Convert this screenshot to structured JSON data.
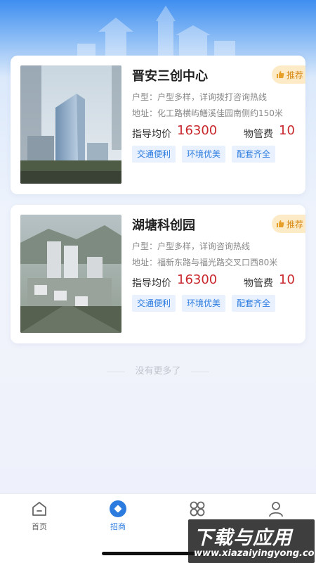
{
  "header": {
    "skyline_icon": "city-skyline-decoration"
  },
  "listings": [
    {
      "name": "晋安三创中心",
      "badge": "推荐",
      "layout": "户型：户型多样，详询拨打咨询热线",
      "address": "地址：化工路横屿鳝溪佳园南侧约150米",
      "price_label": "指导均价",
      "price": "16300",
      "fee_label": "物管费",
      "fee": "10",
      "tags": [
        "交通便利",
        "环境优美",
        "配套齐全"
      ]
    },
    {
      "name": "湖塘科创园",
      "badge": "推荐",
      "layout": "户型：户型多样，详询咨询热线",
      "address": "地址：福新东路与福光路交叉口西80米",
      "price_label": "指导均价",
      "price": "16300",
      "fee_label": "物管费",
      "fee": "10",
      "tags": [
        "交通便利",
        "环境优美",
        "配套齐全"
      ]
    }
  ],
  "footer_note": "没有更多了",
  "tabbar": {
    "items": [
      {
        "label": "首页",
        "icon": "home-icon",
        "active": false
      },
      {
        "label": "招商",
        "icon": "invest-icon",
        "active": true
      },
      {
        "label": "",
        "icon": "grid-icon",
        "active": false
      },
      {
        "label": "",
        "icon": "user-icon",
        "active": false
      }
    ]
  },
  "watermark": {
    "line1": "下载与应用",
    "line2": "www.xiazaiyingyong.com"
  },
  "colors": {
    "accent": "#2c7bdf",
    "price": "#c8282d",
    "badge_bg": "#fdebc8",
    "badge_text": "#d68a17"
  }
}
